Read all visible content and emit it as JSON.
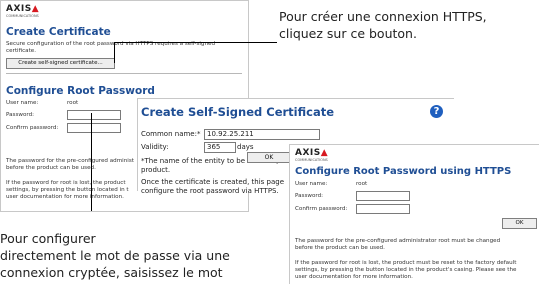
{
  "callouts": {
    "top_right_line1": "Pour créer une connexion HTTPS,",
    "top_right_line2": "cliquez sur ce bouton.",
    "bottom_left_line1": "Pour configurer",
    "bottom_left_line2": "directement le mot de passe via une",
    "bottom_left_line3": "connexion cryptée, saisissez le mot"
  },
  "panel_certificate": {
    "logo": "AXIS",
    "logo_tagline": "COMMUNICATIONS",
    "title": "Create Certificate",
    "description_line1": "Secure configuration of the root password via HTTPS requires a self-signed",
    "description_line2": "certificate.",
    "button": "Create self-signed certificate...",
    "section_title": "Configure Root Password",
    "user_name_label": "User name:",
    "user_name_value": "root",
    "password_label": "Password:",
    "confirm_label": "Confirm password:",
    "note1_line1": "The password for the pre-configured administ",
    "note1_line2": "before the product can be used.",
    "note2_line1": "If the password for root is lost, the product",
    "note2_line2": "settings, by pressing the button located in t",
    "note2_line3": "user documentation for more information."
  },
  "panel_self_signed": {
    "title": "Create Self-Signed Certificate",
    "help_icon": "?",
    "common_name_label": "Common name:",
    "common_name_required": "*",
    "common_name_value": "10.92.25.211",
    "validity_label": "Validity:",
    "validity_value": "365",
    "validity_unit": "days",
    "footnote_line1": "*The name of the entity to be certified, i.",
    "footnote_line2": "product.",
    "ok_button": "OK",
    "after_line1": "Once the certificate is created, this page",
    "after_line2": "configure the root password via HTTPS."
  },
  "panel_https": {
    "logo": "AXIS",
    "logo_tagline": "COMMUNICATIONS",
    "title": "Configure Root Password using HTTPS",
    "user_name_label": "User name:",
    "user_name_value": "root",
    "password_label": "Password:",
    "confirm_label": "Confirm password:",
    "ok_button": "OK",
    "note1_line1": "The password for the pre-configured administrator root must be changed",
    "note1_line2": "before the product can be used.",
    "note2_line1": "If the password for root is lost, the product must be reset to the factory default",
    "note2_line2": "settings, by pressing the button located in the product's casing. Please see the",
    "note2_line3": "user documentation for more information."
  },
  "colors": {
    "title_blue": "#1f4e94",
    "logo_red": "#d71920",
    "help_blue": "#1f5fbf"
  }
}
